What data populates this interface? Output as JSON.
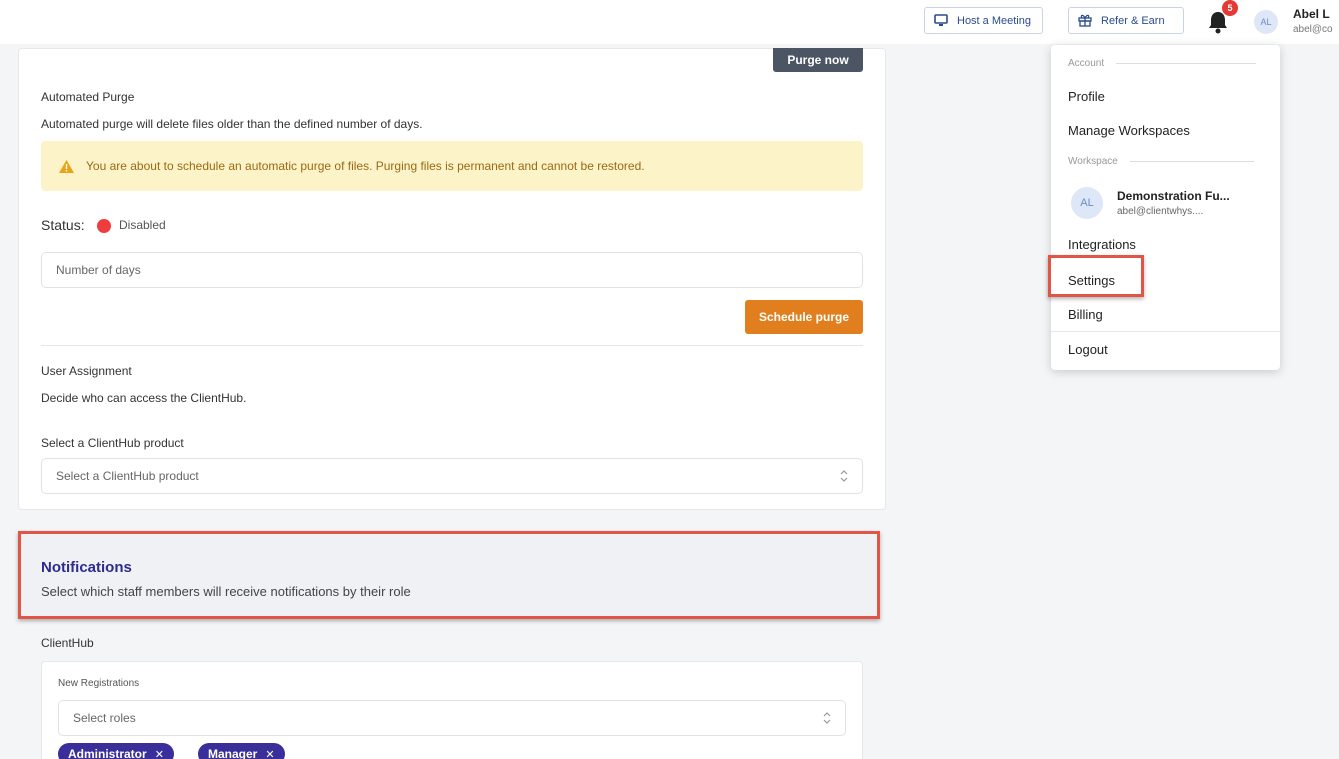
{
  "topbar": {
    "host_label": "Host a Meeting",
    "refer_label": "Refer & Earn",
    "notification_count": "5",
    "avatar_initials": "AL",
    "user_name": "Abel L",
    "user_email": "abel@co"
  },
  "purge": {
    "purge_now_label": "Purge now",
    "heading": "Automated Purge",
    "description": "Automated purge will delete files older than the defined number of days.",
    "warning": "You are about to schedule an automatic purge of files. Purging files is permanent and cannot be restored.",
    "status_label": "Status:",
    "status_value": "Disabled",
    "days_placeholder": "Number of days",
    "schedule_label": "Schedule purge"
  },
  "user_assignment": {
    "heading": "User Assignment",
    "description": "Decide who can access the ClientHub.",
    "select_label": "Select a ClientHub product",
    "select_placeholder": "Select a ClientHub product"
  },
  "notifications": {
    "title": "Notifications",
    "subtitle": "Select which staff members will receive notifications by their role",
    "section_label": "ClientHub",
    "field_label": "New Registrations",
    "roles_placeholder": "Select roles",
    "chips": [
      "Administrator",
      "Manager"
    ]
  },
  "dropdown": {
    "account_label": "Account",
    "profile": "Profile",
    "manage_workspaces": "Manage Workspaces",
    "workspace_label": "Workspace",
    "workspace_initials": "AL",
    "workspace_name": "Demonstration Fu...",
    "workspace_email": "abel@clientwhys....",
    "integrations": "Integrations",
    "settings": "Settings",
    "billing": "Billing",
    "logout": "Logout"
  },
  "colors": {
    "accent_orange": "#e17f1e",
    "chip_purple": "#3a2f9a",
    "highlight_red": "#e05545",
    "status_red": "#ef3d3d"
  }
}
